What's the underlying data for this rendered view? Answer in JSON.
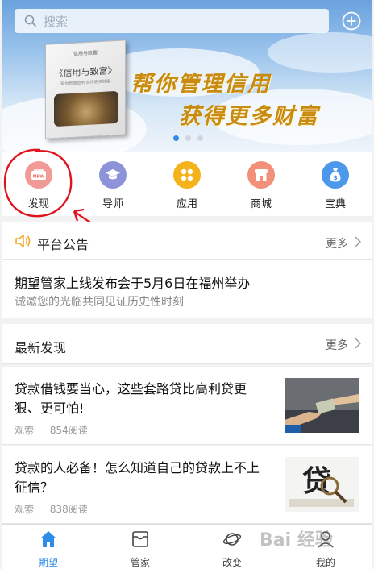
{
  "search": {
    "placeholder": "搜索"
  },
  "banner": {
    "book_series": "信用与政富",
    "book_title": "《信用与致富》",
    "book_subtitle": "帮你管理信用 获得更多财富",
    "slogan_line1": "帮你管理信用",
    "slogan_line2": "获得更多财富",
    "carousel": {
      "count": 3,
      "active": 0
    }
  },
  "nav": {
    "items": [
      {
        "label": "发现",
        "icon": "new-badge-icon",
        "color": "#f29a96"
      },
      {
        "label": "导师",
        "icon": "graduation-cap-icon",
        "color": "#8c93d8"
      },
      {
        "label": "应用",
        "icon": "apps-grid-icon",
        "color": "#f5b21b"
      },
      {
        "label": "商城",
        "icon": "store-icon",
        "color": "#f3907a"
      },
      {
        "label": "宝典",
        "icon": "money-bag-icon",
        "color": "#4c98ea"
      }
    ]
  },
  "notice": {
    "title": "平台公告",
    "more": "更多",
    "main": "期望管家上线发布会于5月6日在福州举办",
    "sub": "诚邀您的光临共同见证历史性时刻"
  },
  "discoveries": {
    "title": "最新发现",
    "more": "更多",
    "articles": [
      {
        "title": "贷款借钱要当心，这些套路贷比高利贷更狠、更可怕!",
        "source": "观索",
        "reads": "854阅读"
      },
      {
        "title": "贷款的人必备！怎么知道自己的贷款上不上征信？",
        "source": "观索",
        "reads": "838阅读"
      }
    ]
  },
  "tabbar": {
    "items": [
      {
        "label": "期望",
        "icon": "home-icon",
        "active": true
      },
      {
        "label": "管家",
        "icon": "inbox-icon",
        "active": false
      },
      {
        "label": "改变",
        "icon": "planet-icon",
        "active": false
      },
      {
        "label": "我的",
        "icon": "user-icon",
        "active": false
      }
    ]
  },
  "colors": {
    "accent": "#2f8ce8",
    "slogan": "#c98a10",
    "annotation": "#e0141e"
  },
  "watermark": "Bai 经验"
}
